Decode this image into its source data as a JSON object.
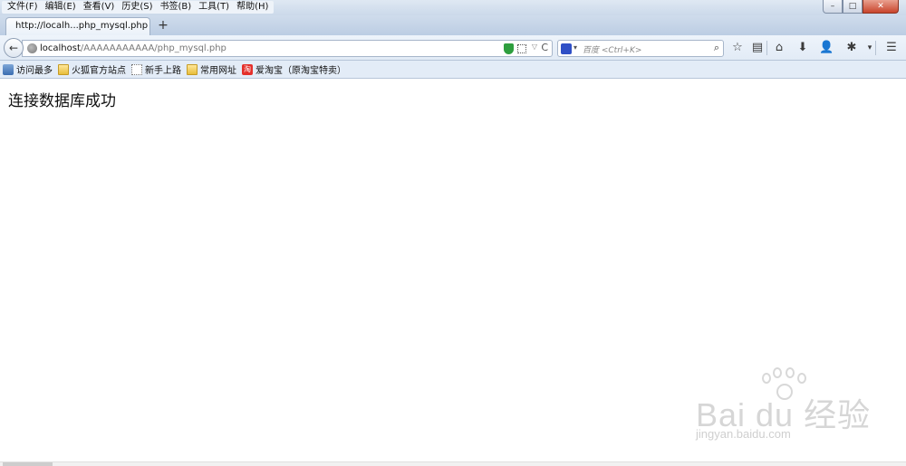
{
  "menubar": {
    "items": [
      "文件(F)",
      "编辑(E)",
      "查看(V)",
      "历史(S)",
      "书签(B)",
      "工具(T)",
      "帮助(H)"
    ]
  },
  "window": {
    "minimize": "–",
    "maximize": "□",
    "close": "✕"
  },
  "tab": {
    "title": "http://localh...php_mysql.php",
    "new_tab": "+"
  },
  "nav": {
    "back": "←",
    "url_host": "localhost",
    "url_path": "/AAAAAAAAAAA/php_mysql.php",
    "search_placeholder": "百度 <Ctrl+K>",
    "search_go": "⌕",
    "reload": "C",
    "dropdown": "▽",
    "icons": {
      "star": "☆",
      "reader": "▤",
      "home": "⌂",
      "download": "⬇",
      "account": "👤",
      "addon": "✱",
      "menu": "☰"
    }
  },
  "bookmarks": [
    {
      "label": "访问最多",
      "icon": "history-icon"
    },
    {
      "label": "火狐官方站点",
      "icon": "folder-icon"
    },
    {
      "label": "新手上路",
      "icon": "page-icon"
    },
    {
      "label": "常用网址",
      "icon": "folder-icon"
    },
    {
      "label": "爱淘宝（原淘宝特卖）",
      "icon": "taobao-icon"
    }
  ],
  "taobao_badge": "淘",
  "page": {
    "message": "连接数据库成功"
  },
  "watermark": {
    "brand": "Bai du 经验",
    "url": "jingyan.baidu.com"
  },
  "colors": {
    "accent": "#2f4fc6",
    "shield": "#2e9e3e",
    "close": "#c8442b"
  }
}
